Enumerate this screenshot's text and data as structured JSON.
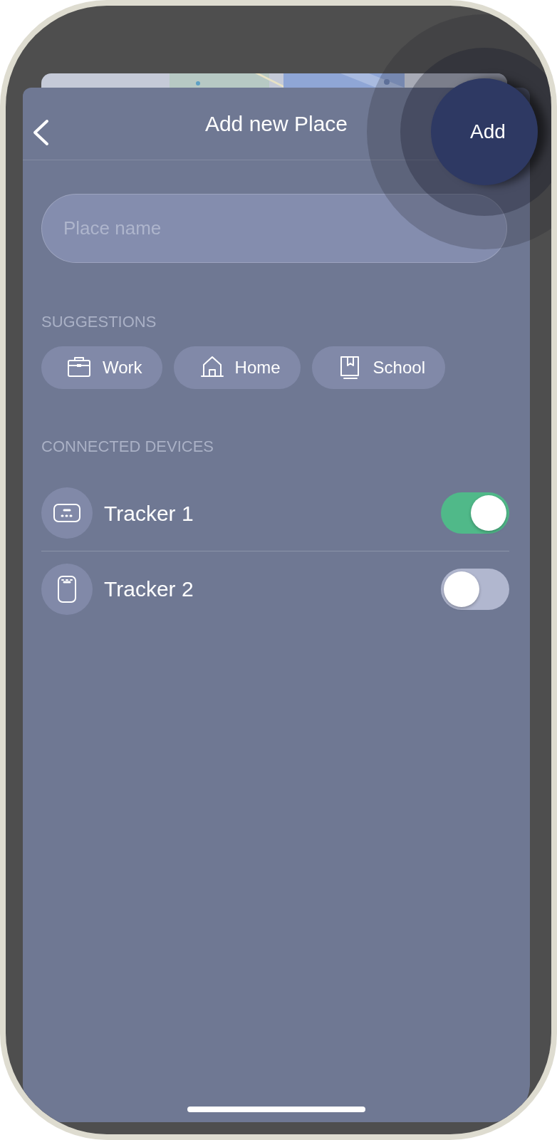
{
  "header": {
    "title": "Add new Place",
    "action": "Add"
  },
  "field": {
    "placeholder": "Place name"
  },
  "suggestions": {
    "heading": "SUGGESTIONS",
    "chips": [
      {
        "label": "Work",
        "kind": "work"
      },
      {
        "label": "Home",
        "kind": "home"
      },
      {
        "label": "School",
        "kind": "school"
      }
    ]
  },
  "devices": {
    "heading": "CONNECTED DEVICES",
    "items": [
      {
        "name": "Tracker 1",
        "kind": "card",
        "on": true
      },
      {
        "name": "Tracker 2",
        "kind": "tag",
        "on": false
      }
    ]
  }
}
